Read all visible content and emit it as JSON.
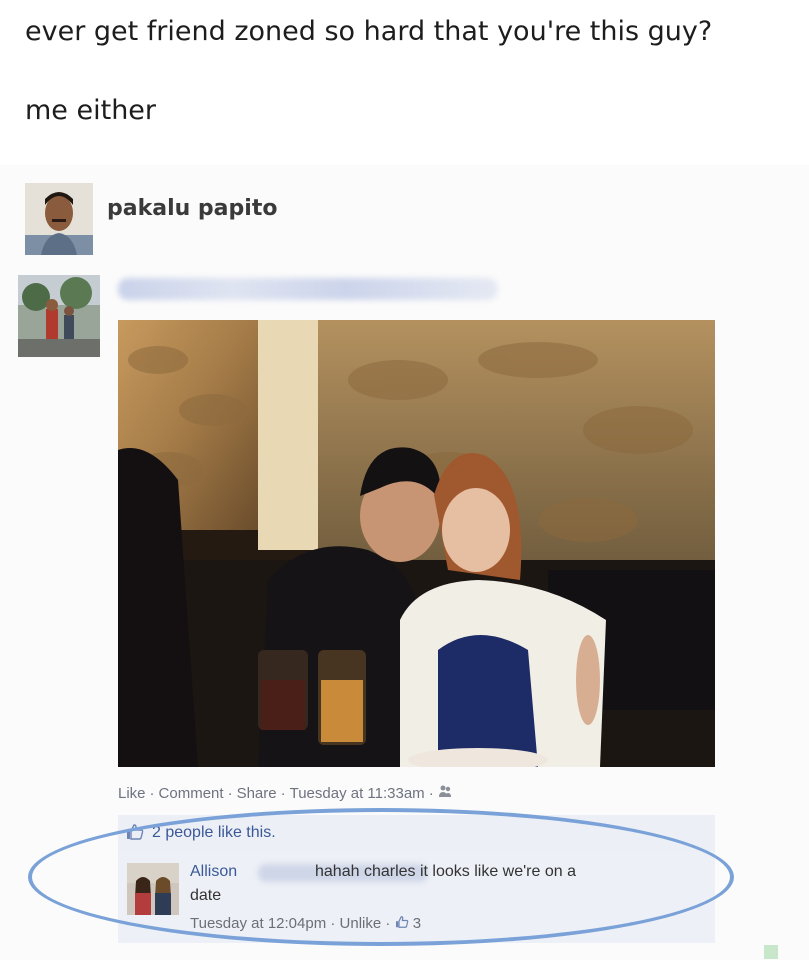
{
  "caption": {
    "line1": "ever get friend zoned so hard that you're this guy?",
    "line2": "me either"
  },
  "post": {
    "poster_name": "pakalu papito",
    "avatar_icon": "person-photo-icon",
    "tagged_line_icon": "blurred-text",
    "actions": {
      "like": "Like",
      "comment": "Comment",
      "share": "Share",
      "timestamp": "Tuesday at 11:33am",
      "separator": "·",
      "audience_icon": "friends-icon"
    },
    "likes_text": "2 people like this.",
    "comment": {
      "author": "Allison",
      "text": "hahah charles it looks like we're on a",
      "text_continued": "date",
      "time": "Tuesday at 12:04pm",
      "unlike": "Unlike",
      "like_count": "3"
    }
  },
  "colors": {
    "link": "#3b5998",
    "highlight_ellipse": "#7aa2d8",
    "comment_bg": "#edf0f6"
  }
}
